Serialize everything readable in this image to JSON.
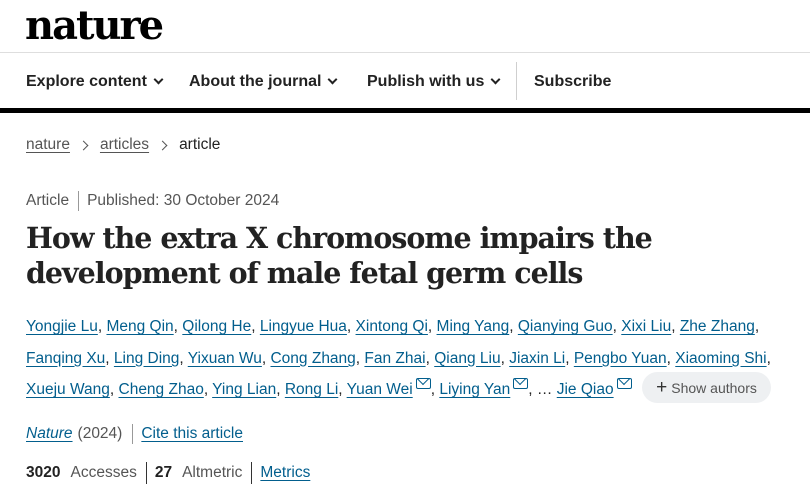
{
  "site": {
    "logo": "nature"
  },
  "nav": {
    "explore": "Explore content",
    "about": "About the journal",
    "publish": "Publish with us",
    "subscribe": "Subscribe"
  },
  "breadcrumb": {
    "home": "nature",
    "section": "articles",
    "current": "article"
  },
  "article": {
    "type": "Article",
    "published": "Published: 30 October 2024",
    "title": "How the extra X chromosome impairs the development of male fetal germ cells",
    "authors": [
      "Yongjie Lu",
      "Meng Qin",
      "Qilong He",
      "Lingyue Hua",
      "Xintong Qi",
      "Ming Yang",
      "Qianying Guo",
      "Xixi Liu",
      "Zhe Zhang",
      "Fanqing Xu",
      "Ling Ding",
      "Yixuan Wu",
      "Cong Zhang",
      "Fan Zhai",
      "Qiang Liu",
      "Jiaxin Li",
      "Pengbo Yuan",
      "Xiaoming Shi",
      "Xueju Wang",
      "Cheng Zhao",
      "Ying Lian",
      "Rong Li",
      "Yuan Wei",
      "Liying Yan",
      "Jie Qiao"
    ],
    "ellipsis": "…",
    "show_authors": "Show authors",
    "journal": "Nature",
    "year": "(2024)",
    "cite": "Cite this article"
  },
  "metrics": {
    "accesses_value": "3020",
    "accesses_label": "Accesses",
    "altmetric_value": "27",
    "altmetric_label": "Altmetric",
    "metrics_link": "Metrics"
  },
  "colors": {
    "link": "#025e8d",
    "rule": "#000000"
  }
}
